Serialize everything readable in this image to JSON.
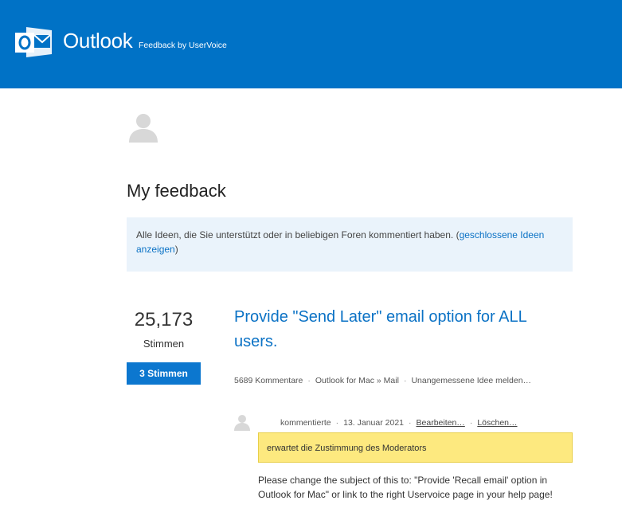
{
  "header": {
    "brand": "Outlook",
    "subtitle": "Feedback by UserVoice",
    "background_color": "#0072c6",
    "logo_icon": "outlook-logo-icon"
  },
  "main": {
    "title": "My feedback",
    "info": {
      "text": "Alle Ideen, die Sie unterstützt oder in beliebigen Foren kommentiert haben. (",
      "link": "geschlossene Ideen anzeigen",
      "suffix": ")"
    }
  },
  "idea": {
    "vote_count": "25,173",
    "vote_label": "Stimmen",
    "vote_button": "3 Stimmen",
    "title": "Provide \"Send Later\" email option for ALL users.",
    "comments": "5689 Kommentare",
    "forum": "Outlook for Mac » Mail",
    "report": "Unangemessene Idee melden…"
  },
  "comment": {
    "action": "kommentierte",
    "date": "13. Januar 2021",
    "edit": "Bearbeiten…",
    "delete": "Löschen…",
    "status": "erwartet die Zustimmung des Moderators",
    "text": "Please change the subject of this to: \"Provide 'Recall email' option in Outlook for Mac\" or link to the right Uservoice page in your help page!"
  },
  "colors": {
    "accent": "#0b72c5",
    "button": "#0c77cf",
    "info_bg": "#eaf3fb",
    "status_bg": "#fde97f"
  }
}
